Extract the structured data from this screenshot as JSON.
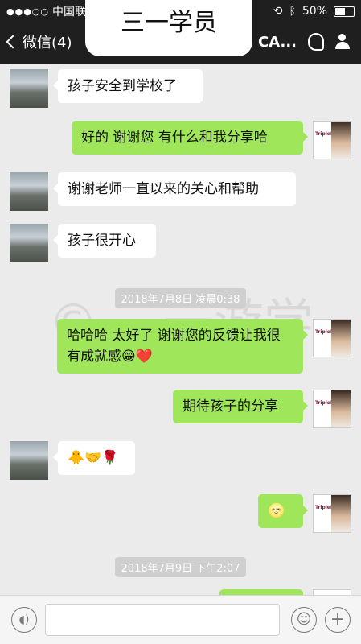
{
  "status": {
    "carrier": "中国联通",
    "battery": "50%"
  },
  "nav": {
    "back_label": "微信(4)",
    "contact_short": "CA..."
  },
  "overlay_title": "三一学员",
  "watermark": "© 三一游学",
  "messages": [
    {
      "side": "left",
      "text": "孩子安全到学校了"
    },
    {
      "side": "right",
      "text": "好的 谢谢您 有什么和我分享哈"
    },
    {
      "side": "left",
      "text": "谢谢老师一直以来的关心和帮助"
    },
    {
      "side": "left",
      "text": "孩子很开心"
    },
    {
      "timestamp": "2018年7月8日 凌晨0:38"
    },
    {
      "side": "right",
      "text": "哈哈哈 太好了 谢谢您的反馈让我很有成就感😁❤️"
    },
    {
      "side": "right",
      "text": "期待孩子的分享"
    },
    {
      "side": "left",
      "text": "🐥🤝🌹"
    },
    {
      "side": "right",
      "text": "🌝"
    },
    {
      "timestamp": "2018年7月9日 下午2:07"
    }
  ],
  "avatar_right_logo": "TripleE",
  "input": {
    "placeholder": ""
  }
}
